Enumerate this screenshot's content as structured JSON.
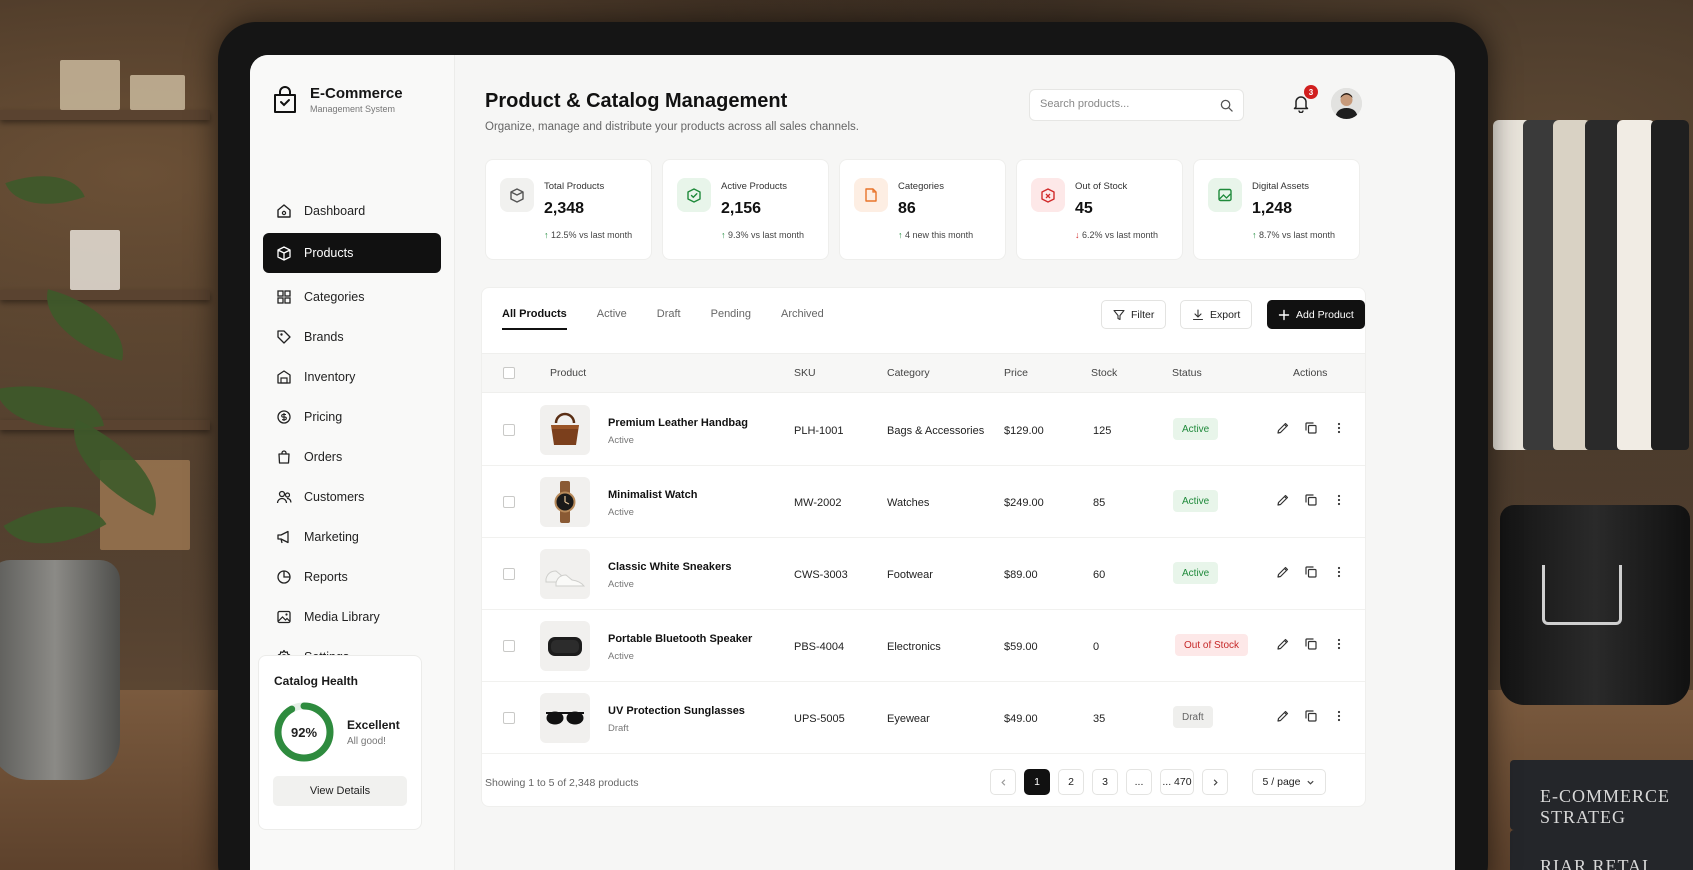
{
  "brand": {
    "title": "E-Commerce",
    "subtitle": "Management System"
  },
  "sidebar": {
    "items": [
      {
        "label": "Dashboard",
        "icon": "home-icon"
      },
      {
        "label": "Products",
        "icon": "box-icon",
        "active": true
      },
      {
        "label": "Categories",
        "icon": "grid-icon"
      },
      {
        "label": "Brands",
        "icon": "tag-icon"
      },
      {
        "label": "Inventory",
        "icon": "warehouse-icon"
      },
      {
        "label": "Pricing",
        "icon": "dollar-icon"
      },
      {
        "label": "Orders",
        "icon": "bag-icon"
      },
      {
        "label": "Customers",
        "icon": "users-icon"
      },
      {
        "label": "Marketing",
        "icon": "megaphone-icon"
      },
      {
        "label": "Reports",
        "icon": "chart-icon"
      },
      {
        "label": "Media Library",
        "icon": "image-icon"
      },
      {
        "label": "Settings",
        "icon": "gear-icon"
      }
    ]
  },
  "health": {
    "title": "Catalog Health",
    "percent": 92,
    "percent_label": "92%",
    "status": "Excellent",
    "note": "All good!",
    "button": "View Details"
  },
  "header": {
    "title": "Product & Catalog Management",
    "subtitle": "Organize, manage and distribute your products across all sales channels.",
    "search_placeholder": "Search products...",
    "notifications": "3"
  },
  "stats": [
    {
      "label": "Total Products",
      "value": "2,348",
      "change": "12.5%",
      "suffix": "vs last month",
      "trend": "up",
      "color": "#555555",
      "bg": "#f1f1ef"
    },
    {
      "label": "Active Products",
      "value": "2,156",
      "change": "9.3%",
      "suffix": "vs last month",
      "trend": "up",
      "color": "#1f8a3b",
      "bg": "#e8f5ea"
    },
    {
      "label": "Categories",
      "value": "86",
      "change": "4 new",
      "suffix": "this month",
      "trend": "up",
      "color": "#e8742a",
      "bg": "#fdeee3"
    },
    {
      "label": "Out of Stock",
      "value": "45",
      "change": "6.2%",
      "suffix": "vs last month",
      "trend": "down",
      "color": "#d12b2b",
      "bg": "#fde8e8"
    },
    {
      "label": "Digital Assets",
      "value": "1,248",
      "change": "8.7%",
      "suffix": "vs last month",
      "trend": "up",
      "color": "#1f8a3b",
      "bg": "#e8f5ea"
    }
  ],
  "tabs": [
    "All Products",
    "Active",
    "Draft",
    "Pending",
    "Archived"
  ],
  "buttons": {
    "filter": "Filter",
    "export": "Export",
    "add": "Add Product"
  },
  "columns": [
    "Product",
    "SKU",
    "Category",
    "Price",
    "Stock",
    "Status",
    "Actions"
  ],
  "products": [
    {
      "name": "Premium Leather Handbag",
      "sub": "Active",
      "sku": "PLH-1001",
      "category": "Bags & Accessories",
      "price": "$129.00",
      "stock": "125",
      "status": "Active",
      "tone": "green",
      "thumb": "handbag"
    },
    {
      "name": "Minimalist Watch",
      "sub": "Active",
      "sku": "MW-2002",
      "category": "Watches",
      "price": "$249.00",
      "stock": "85",
      "status": "Active",
      "tone": "green",
      "thumb": "watch"
    },
    {
      "name": "Classic White Sneakers",
      "sub": "Active",
      "sku": "CWS-3003",
      "category": "Footwear",
      "price": "$89.00",
      "stock": "60",
      "status": "Active",
      "tone": "green",
      "thumb": "sneakers"
    },
    {
      "name": "Portable Bluetooth Speaker",
      "sub": "Active",
      "sku": "PBS-4004",
      "category": "Electronics",
      "price": "$59.00",
      "stock": "0",
      "status": "Out of Stock",
      "tone": "red",
      "thumb": "speaker"
    },
    {
      "name": "UV Protection Sunglasses",
      "sub": "Draft",
      "sku": "UPS-5005",
      "category": "Eyewear",
      "price": "$49.00",
      "stock": "35",
      "status": "Draft",
      "tone": "gray",
      "thumb": "sunglasses"
    }
  ],
  "footer": {
    "showing": "Showing 1 to 5 of 2,348 products",
    "pages": [
      "1",
      "2",
      "3",
      "...",
      "... 470"
    ],
    "per_page": "5 / page"
  },
  "scene": {
    "mug_icon": "cart-icon",
    "book_title_1": "E-COMMERCE STRATEG",
    "book_title_2": "RIAR RETAI"
  }
}
